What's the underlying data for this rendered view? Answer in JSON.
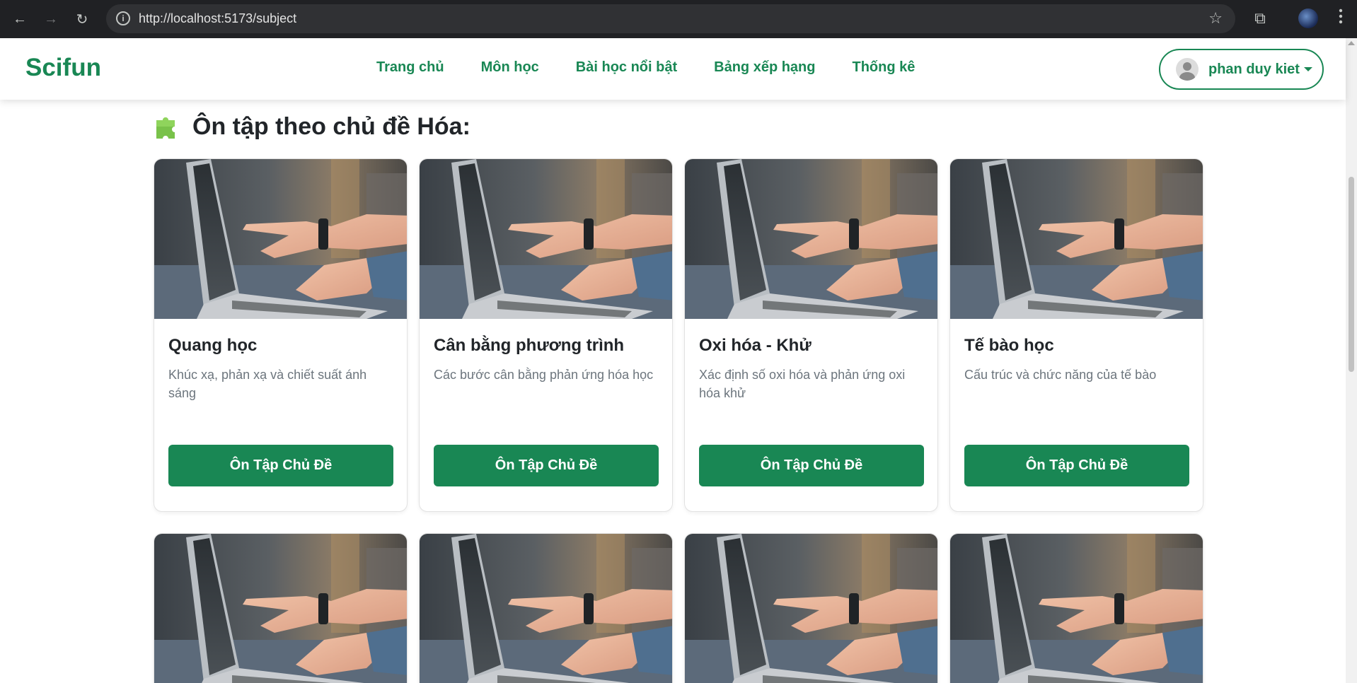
{
  "browser": {
    "url": "http://localhost:5173/subject",
    "info_glyph": "i",
    "star_glyph": "☆",
    "extensions_glyph": "⧉",
    "back_glyph": "←",
    "forward_glyph": "→",
    "reload_glyph": "↻"
  },
  "navbar": {
    "brand": "Scifun",
    "links": [
      "Trang chủ",
      "Môn học",
      "Bài học nổi bật",
      "Bảng xếp hạng",
      "Thống kê"
    ],
    "user_name": "phan duy kiet"
  },
  "section": {
    "title": "Ôn tập theo chủ đề Hóa:",
    "icon": "puzzle-piece-icon"
  },
  "cards": [
    {
      "title": "Quang học",
      "description": "Khúc xạ, phản xạ và chiết suất ánh sáng",
      "button": "Ôn Tập Chủ Đề"
    },
    {
      "title": "Cân bằng phương trình",
      "description": "Các bước cân bằng phản ứng hóa học",
      "button": "Ôn Tập Chủ Đề"
    },
    {
      "title": "Oxi hóa - Khử",
      "description": "Xác định số oxi hóa và phản ứng oxi hóa khử",
      "button": "Ôn Tập Chủ Đề"
    },
    {
      "title": "Tế bào học",
      "description": "Cấu trúc và chức năng của tế bào",
      "button": "Ôn Tập Chủ Đề"
    }
  ],
  "colors": {
    "brand_green": "#198754",
    "browser_dark": "#202124"
  }
}
